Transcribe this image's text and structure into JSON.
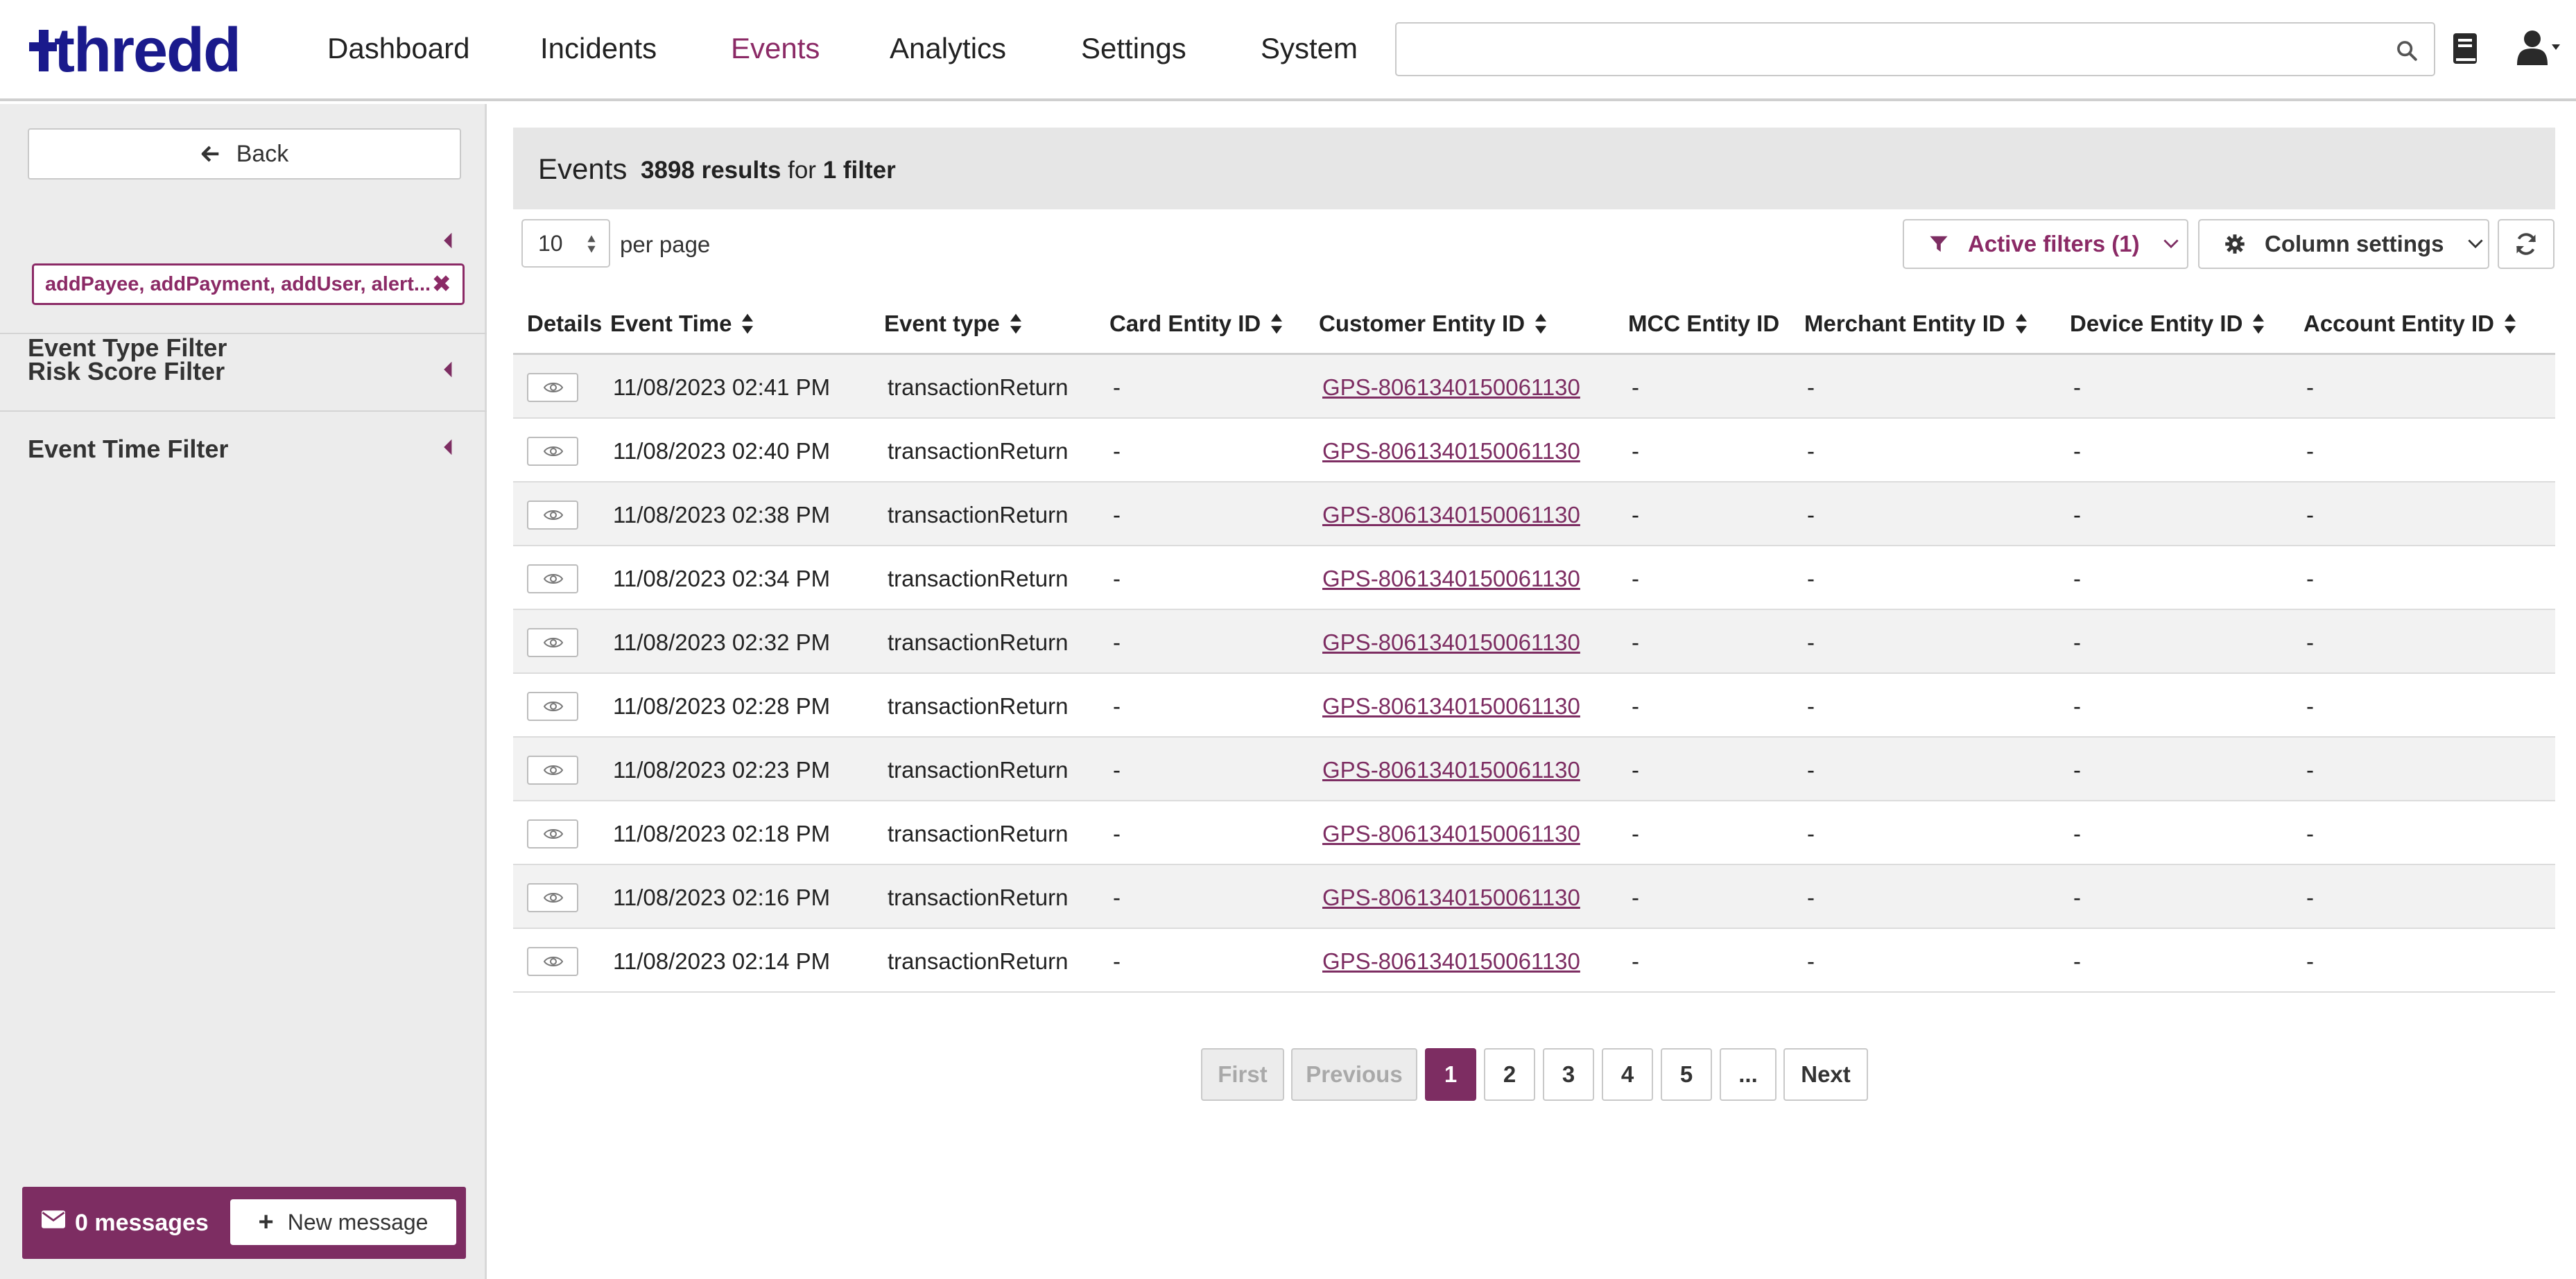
{
  "app": {
    "logo_text": "thredd"
  },
  "nav": {
    "items": [
      {
        "label": "Dashboard"
      },
      {
        "label": "Incidents"
      },
      {
        "label": "Events"
      },
      {
        "label": "Analytics"
      },
      {
        "label": "Settings"
      },
      {
        "label": "System"
      }
    ],
    "active": "Events",
    "search": {
      "value": "",
      "placeholder": ""
    }
  },
  "sidebar": {
    "back_label": "Back",
    "filters": [
      {
        "title": "Event Type Filter"
      },
      {
        "title": "Risk Score Filter"
      },
      {
        "title": "Event Time Filter"
      }
    ],
    "event_type_tag": "addPayee, addPayment, addUser, alert...",
    "messages": {
      "count_label": "0 messages",
      "new_label": "New message"
    }
  },
  "main": {
    "title": "Events",
    "result_count": "3898 results",
    "for_label": "for",
    "filter_count": "1 filter",
    "per_page_value": "10",
    "per_page_label": "per page",
    "active_filters_label": "Active filters (1)",
    "column_settings_label": "Column settings",
    "columns": [
      "Details",
      "Event Time",
      "Event type",
      "Card Entity ID",
      "Customer Entity ID",
      "MCC Entity ID",
      "Merchant Entity ID",
      "Device Entity ID",
      "Account Entity ID"
    ],
    "rows": [
      {
        "time": "11/08/2023 02:41 PM",
        "type": "transactionReturn",
        "card": "-",
        "customer": "GPS-8061340150061130",
        "mcc": "-",
        "merchant": "-",
        "device": "-",
        "account": "-"
      },
      {
        "time": "11/08/2023 02:40 PM",
        "type": "transactionReturn",
        "card": "-",
        "customer": "GPS-8061340150061130",
        "mcc": "-",
        "merchant": "-",
        "device": "-",
        "account": "-"
      },
      {
        "time": "11/08/2023 02:38 PM",
        "type": "transactionReturn",
        "card": "-",
        "customer": "GPS-8061340150061130",
        "mcc": "-",
        "merchant": "-",
        "device": "-",
        "account": "-"
      },
      {
        "time": "11/08/2023 02:34 PM",
        "type": "transactionReturn",
        "card": "-",
        "customer": "GPS-8061340150061130",
        "mcc": "-",
        "merchant": "-",
        "device": "-",
        "account": "-"
      },
      {
        "time": "11/08/2023 02:32 PM",
        "type": "transactionReturn",
        "card": "-",
        "customer": "GPS-8061340150061130",
        "mcc": "-",
        "merchant": "-",
        "device": "-",
        "account": "-"
      },
      {
        "time": "11/08/2023 02:28 PM",
        "type": "transactionReturn",
        "card": "-",
        "customer": "GPS-8061340150061130",
        "mcc": "-",
        "merchant": "-",
        "device": "-",
        "account": "-"
      },
      {
        "time": "11/08/2023 02:23 PM",
        "type": "transactionReturn",
        "card": "-",
        "customer": "GPS-8061340150061130",
        "mcc": "-",
        "merchant": "-",
        "device": "-",
        "account": "-"
      },
      {
        "time": "11/08/2023 02:18 PM",
        "type": "transactionReturn",
        "card": "-",
        "customer": "GPS-8061340150061130",
        "mcc": "-",
        "merchant": "-",
        "device": "-",
        "account": "-"
      },
      {
        "time": "11/08/2023 02:16 PM",
        "type": "transactionReturn",
        "card": "-",
        "customer": "GPS-8061340150061130",
        "mcc": "-",
        "merchant": "-",
        "device": "-",
        "account": "-"
      },
      {
        "time": "11/08/2023 02:14 PM",
        "type": "transactionReturn",
        "card": "-",
        "customer": "GPS-8061340150061130",
        "mcc": "-",
        "merchant": "-",
        "device": "-",
        "account": "-"
      }
    ],
    "pagination": {
      "first": "First",
      "previous": "Previous",
      "pages": [
        "1",
        "2",
        "3",
        "4",
        "5"
      ],
      "ellipsis": "...",
      "next": "Next",
      "current": "1"
    }
  },
  "colors": {
    "brand_navy": "#1a1a8c",
    "accent_purple": "#7d2d62",
    "nav_active": "#8b2a66"
  },
  "icons": [
    "search-icon",
    "book-icon",
    "user-icon",
    "arrow-left-icon",
    "caret-left-icon",
    "close-icon",
    "envelope-icon",
    "plus-icon",
    "sort-icon",
    "filter-icon",
    "chevron-down-icon",
    "gear-icon",
    "refresh-icon",
    "eye-icon"
  ]
}
